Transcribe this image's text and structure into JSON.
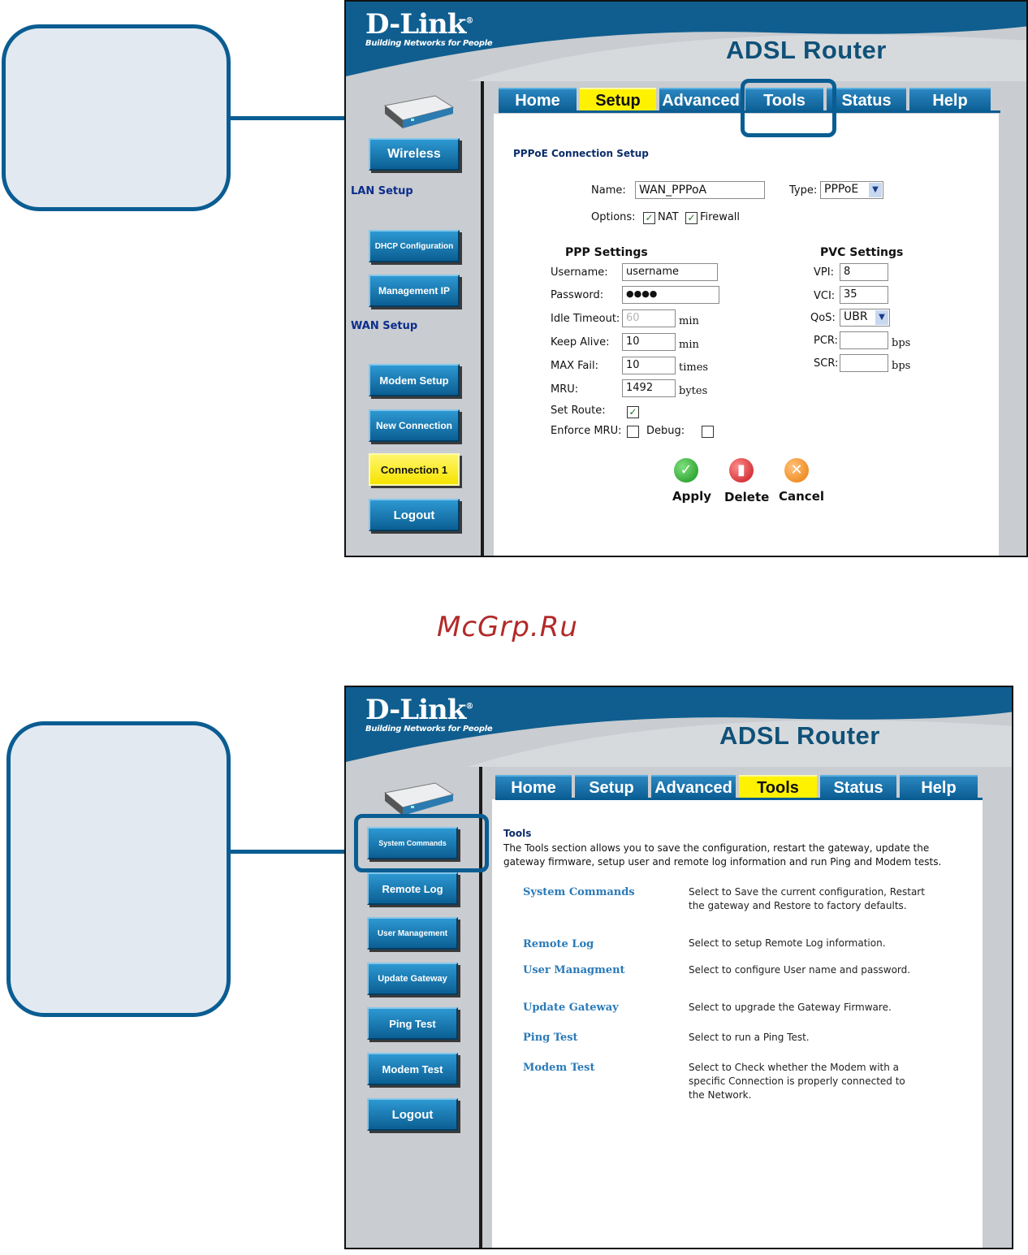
{
  "watermark": "McGrp.Ru",
  "screen1": {
    "brand": "D-Link",
    "reg": "®",
    "slogan": "Building Networks for People",
    "product": "ADSL Router",
    "tabs": [
      "Home",
      "Setup",
      "Advanced",
      "Tools",
      "Status",
      "Help"
    ],
    "active_tab": "Setup",
    "sidebar": {
      "wireless": "Wireless",
      "lan_setup": "LAN Setup",
      "dhcp": "DHCP Configuration",
      "mgmt_ip": "Management IP",
      "wan_setup": "WAN Setup",
      "modem_setup": "Modem Setup",
      "new_connection": "New Connection",
      "connection1": "Connection 1",
      "logout": "Logout"
    },
    "form": {
      "section_title": "PPPoE Connection Setup",
      "name_label": "Name:",
      "name_value": "WAN_PPPoA",
      "type_label": "Type:",
      "type_value": "PPPoE",
      "options_label": "Options:",
      "nat_label": "NAT",
      "firewall_label": "Firewall",
      "ppp_heading": "PPP Settings",
      "username_label": "Username:",
      "username_value": "username",
      "password_label": "Password:",
      "password_value": "●●●●",
      "idle_label": "Idle Timeout:",
      "idle_value": "60",
      "idle_unit": "min",
      "keepalive_label": "Keep Alive:",
      "keepalive_value": "10",
      "keepalive_unit": "min",
      "maxfail_label": "MAX Fail:",
      "maxfail_value": "10",
      "maxfail_unit": "times",
      "mru_label": "MRU:",
      "mru_value": "1492",
      "mru_unit": "bytes",
      "setroute_label": "Set Route:",
      "enforce_label": "Enforce MRU:",
      "debug_label": "Debug:",
      "pvc_heading": "PVC Settings",
      "vpi_label": "VPI:",
      "vpi_value": "8",
      "vci_label": "VCI:",
      "vci_value": "35",
      "qos_label": "QoS:",
      "qos_value": "UBR",
      "pcr_label": "PCR:",
      "pcr_unit": "bps",
      "scr_label": "SCR:",
      "scr_unit": "bps",
      "apply": "Apply",
      "delete": "Delete",
      "cancel": "Cancel"
    }
  },
  "screen2": {
    "brand": "D-Link",
    "reg": "®",
    "slogan": "Building Networks for People",
    "product": "ADSL Router",
    "tabs": [
      "Home",
      "Setup",
      "Advanced",
      "Tools",
      "Status",
      "Help"
    ],
    "active_tab": "Tools",
    "sidebar": [
      "System Commands",
      "Remote Log",
      "User Management",
      "Update Gateway",
      "Ping Test",
      "Modem Test",
      "Logout"
    ],
    "heading": "Tools",
    "intro": "The Tools section allows you to save the configuration, restart the gateway, update the gateway firmware, setup user and remote log information and run Ping and Modem tests.",
    "rows": [
      {
        "link": "System Commands",
        "desc": "Select to Save the current configuration, Restart the gateway and Restore to factory defaults."
      },
      {
        "link": "Remote Log",
        "desc": "Select to setup Remote Log information."
      },
      {
        "link": "User Managment",
        "desc": "Select to configure User name and password."
      },
      {
        "link": "Update Gateway",
        "desc": "Select to upgrade the Gateway Firmware."
      },
      {
        "link": "Ping Test",
        "desc": "Select to run a Ping Test."
      },
      {
        "link": "Modem Test",
        "desc": "Select to Check whether the Modem with a specific Connection is properly connected to the Network."
      }
    ]
  },
  "colors": {
    "accent_blue": "#0a5d92",
    "callout_fill": "#e3e9f1",
    "tab_active": "#fff200",
    "link_blue": "#2a7ab8",
    "sidebar_bg": "#c9ccd0",
    "watermark_red": "#b32a2a"
  },
  "icons": {
    "apply": "check-circle-icon",
    "delete": "trash-icon",
    "cancel": "x-circle-icon",
    "device": "router-device-icon"
  }
}
